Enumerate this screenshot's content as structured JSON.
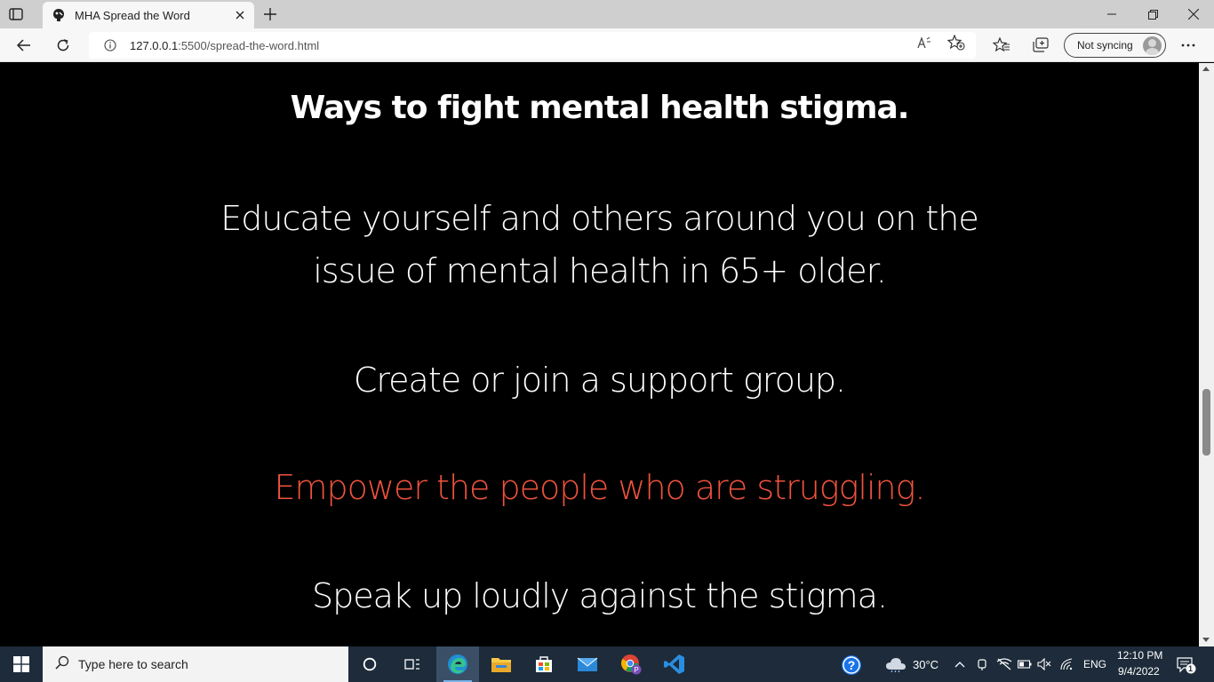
{
  "browser": {
    "tab_title": "MHA Spread the Word",
    "url_host": "127.0.0.1",
    "url_path": ":5500/spread-the-word.html",
    "sync_label": "Not syncing"
  },
  "page": {
    "heading": "Ways to fight mental health stigma.",
    "items": [
      "Educate yourself and others around you on the issue of mental health in 65+ older.",
      "Create or join a support group.",
      "Empower the people who are struggling.",
      "Speak up loudly against the stigma."
    ],
    "highlight_color": "#f0533d"
  },
  "taskbar": {
    "search_placeholder": "Type here to search",
    "weather": "30°C",
    "language": "ENG",
    "time": "12:10 PM",
    "date": "9/4/2022",
    "notification_count": "1"
  }
}
